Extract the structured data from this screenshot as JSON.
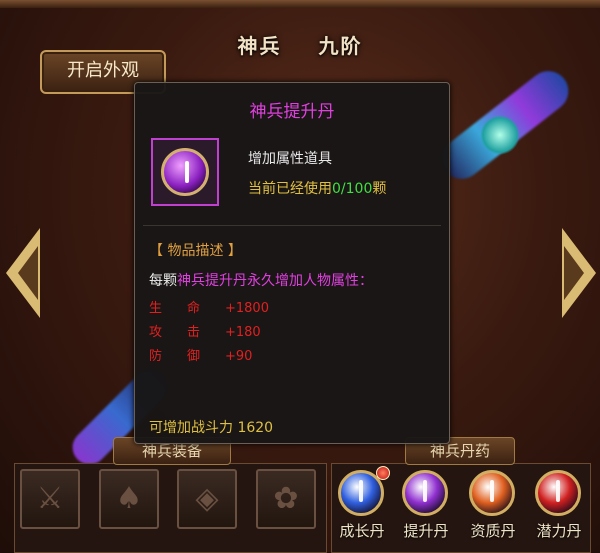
{
  "header": {
    "name": "神兵",
    "rank": "九阶"
  },
  "buttons": {
    "appearance": "开启外观"
  },
  "tooltip": {
    "title": "神兵提升丹",
    "item_type": "增加属性道具",
    "usage_prefix": "当前已经使用",
    "usage_value": "0/100",
    "usage_suffix": "颗",
    "section_label": "【 物品描述 】",
    "desc_prefix": "每颗",
    "desc_highlight": "神兵提升丹永久增加人物属性：",
    "stats": [
      {
        "c1": "生",
        "c2": "命",
        "value": "+1800"
      },
      {
        "c1": "攻",
        "c2": "击",
        "value": "+180"
      },
      {
        "c1": "防",
        "c2": "御",
        "value": "+90"
      }
    ],
    "power": "可增加战斗力 1620"
  },
  "panels": {
    "equipment_label": "神兵装备",
    "pills_label": "神兵丹药"
  },
  "equipment_slots": [
    "sword-slot-icon",
    "weapon-slot-icon",
    "shield-slot-icon",
    "ornament-slot-icon"
  ],
  "pills": [
    {
      "label": "成长丹",
      "color": "#3060e0",
      "badge": true
    },
    {
      "label": "提升丹",
      "color": "#9030d0",
      "badge": false
    },
    {
      "label": "资质丹",
      "color": "#e06020",
      "badge": false
    },
    {
      "label": "潜力丹",
      "color": "#d02020",
      "badge": false
    }
  ]
}
